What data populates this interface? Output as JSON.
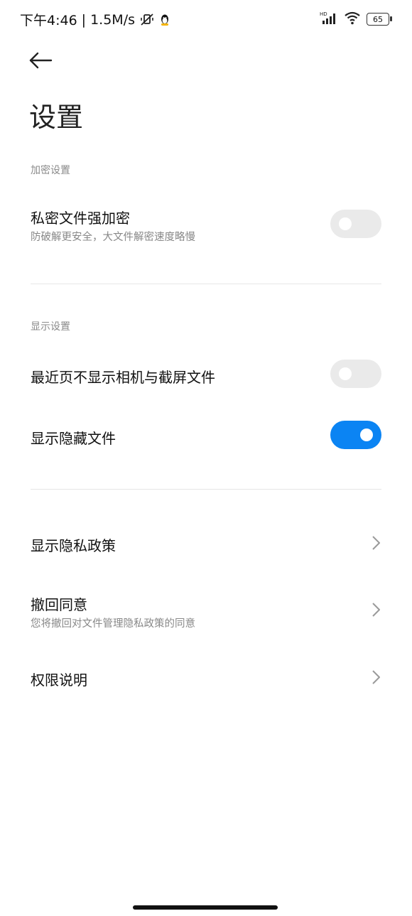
{
  "status_bar": {
    "time": "下午4:46",
    "separator": "|",
    "net_speed": "1.5M/s",
    "icons": [
      "mute-icon",
      "qq-icon",
      "hd-signal-icon",
      "wifi-icon"
    ],
    "battery": "65"
  },
  "header": {
    "title": "设置"
  },
  "sections": {
    "encryption": {
      "label": "加密设置",
      "item": {
        "title": "私密文件强加密",
        "subtitle": "防破解更安全，大文件解密速度略慢",
        "enabled": false
      }
    },
    "display": {
      "label": "显示设置",
      "recent": {
        "title": "最近页不显示相机与截屏文件",
        "enabled": false
      },
      "hidden": {
        "title": "显示隐藏文件",
        "enabled": true
      }
    }
  },
  "links": {
    "privacy": {
      "title": "显示隐私政策"
    },
    "revoke": {
      "title": "撤回同意",
      "subtitle": "您将撤回对文件管理隐私政策的同意"
    },
    "permissions": {
      "title": "权限说明"
    }
  },
  "colors": {
    "accent": "#0b84f3",
    "toggle_off": "#eaeaea"
  }
}
